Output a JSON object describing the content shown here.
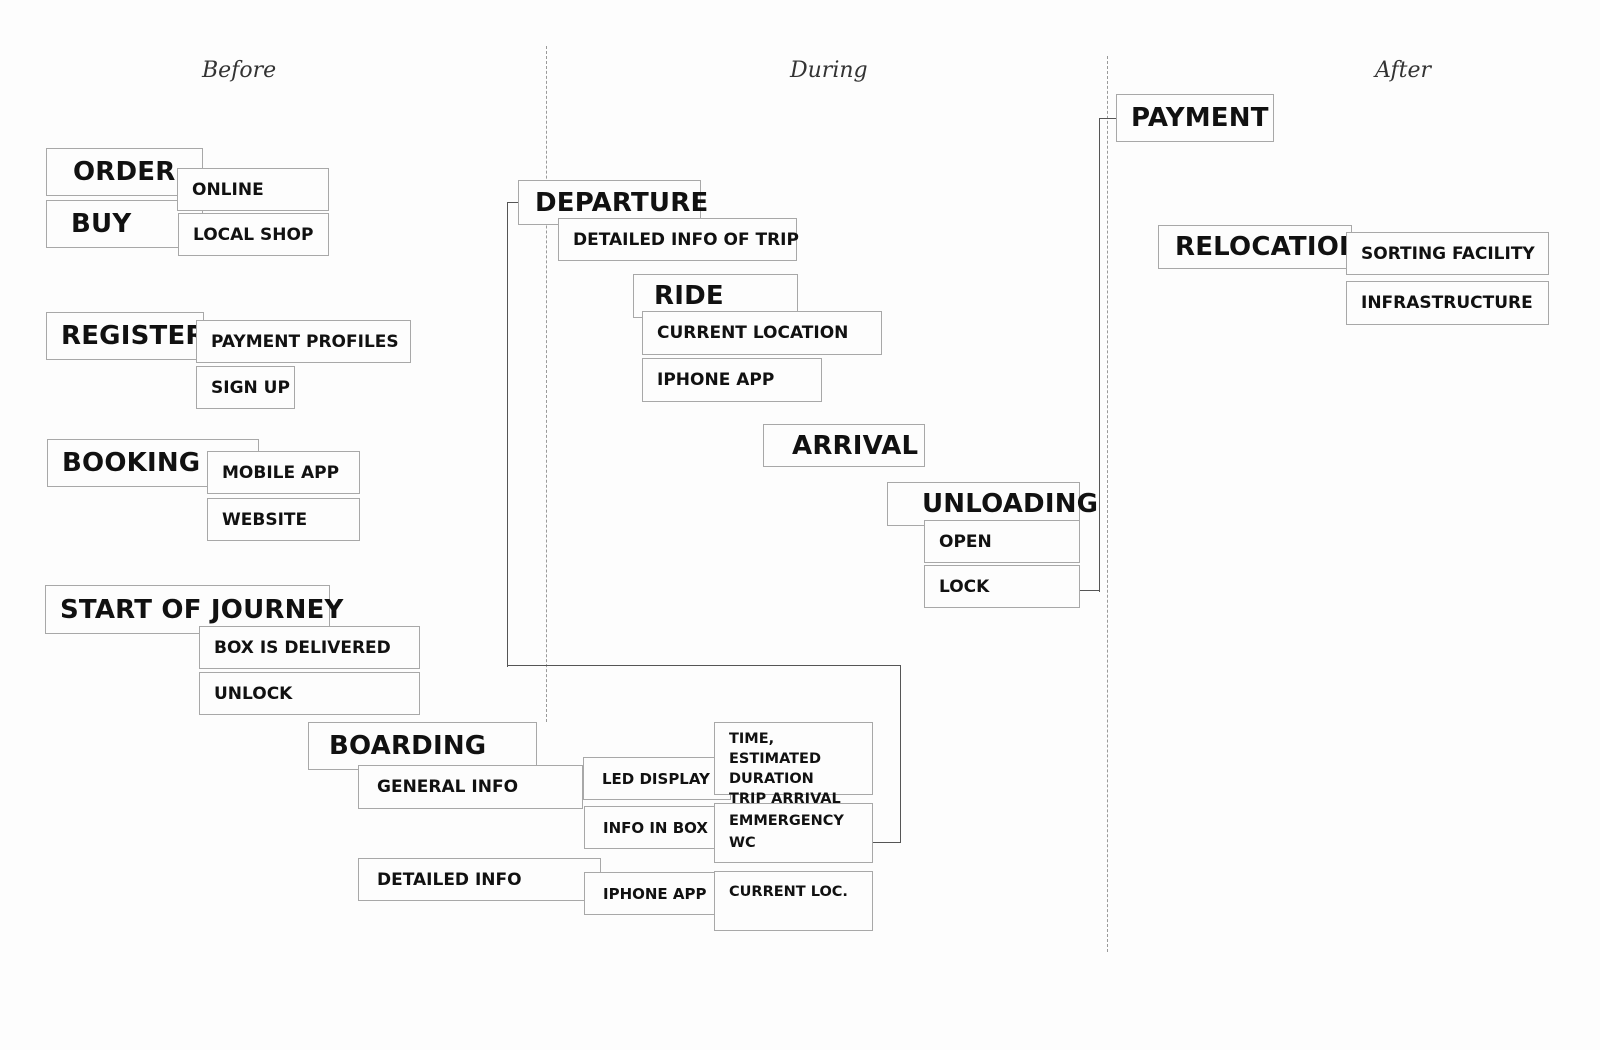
{
  "phases": {
    "before": "Before",
    "during": "During",
    "after": "After"
  },
  "before": {
    "order": {
      "label": "ORDER",
      "children": [
        "ONLINE"
      ]
    },
    "buy": {
      "label": "BUY",
      "children": [
        "LOCAL SHOP"
      ]
    },
    "register": {
      "label": "REGISTER",
      "children": [
        "PAYMENT PROFILES",
        "SIGN UP"
      ]
    },
    "booking": {
      "label": "BOOKING",
      "children": [
        "MOBILE APP",
        "WEBSITE"
      ]
    },
    "start_of_journey": {
      "label": "START OF JOURNEY",
      "children": [
        "BOX IS DELIVERED",
        "UNLOCK"
      ]
    },
    "boarding": {
      "label": "BOARDING",
      "general_info": {
        "label": "GENERAL INFO",
        "led_display": {
          "label": "LED DISPLAY",
          "detail": "TIME, ESTIMATED DURATION TRIP ARRIVAL"
        },
        "info_in_box": {
          "label": "INFO IN BOX",
          "detail": "EMMERGENCY WC"
        }
      },
      "detailed_info": {
        "label": "DETAILED INFO",
        "iphone_app": {
          "label": "IPHONE APP",
          "detail": "CURRENT LOC."
        }
      }
    }
  },
  "during": {
    "departure": {
      "label": "DEPARTURE",
      "children": [
        "DETAILED INFO OF TRIP"
      ]
    },
    "ride": {
      "label": "RIDE",
      "children": [
        "CURRENT LOCATION",
        "IPHONE APP"
      ]
    },
    "arrival": {
      "label": "ARRIVAL"
    },
    "unloading": {
      "label": "UNLOADING",
      "children": [
        "OPEN",
        "LOCK"
      ]
    }
  },
  "after": {
    "payment": {
      "label": "PAYMENT"
    },
    "relocation": {
      "label": "RELOCATION",
      "children": [
        "SORTING FACILITY",
        "INFRASTRUCTURE"
      ]
    }
  },
  "colors": {
    "box_border": "#a8a8a8",
    "connector": "#555555",
    "divider": "#9a9a9a",
    "text": "#111111"
  }
}
